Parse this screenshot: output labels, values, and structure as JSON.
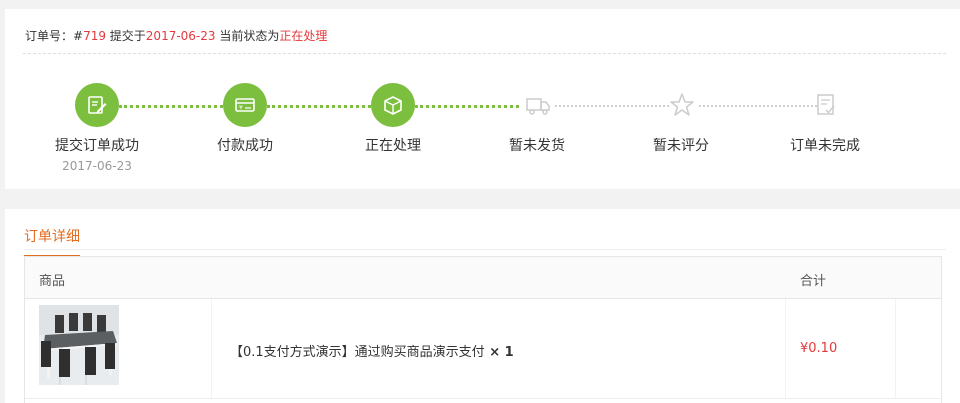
{
  "order": {
    "label_prefix": "订单号：#",
    "number": "719",
    "submitted_label": " 提交于",
    "date": "2017-06-23",
    "status_label": " 当前状态为",
    "status": "正在处理"
  },
  "steps": [
    {
      "label": "提交订单成功",
      "date": "2017-06-23",
      "done": true,
      "icon": "edit-document-icon"
    },
    {
      "label": "付款成功",
      "date": "",
      "done": true,
      "icon": "payment-card-icon"
    },
    {
      "label": "正在处理",
      "date": "",
      "done": true,
      "icon": "package-box-icon"
    },
    {
      "label": "暂未发货",
      "date": "",
      "done": false,
      "icon": "delivery-truck-icon"
    },
    {
      "label": "暂未评分",
      "date": "",
      "done": false,
      "icon": "star-icon"
    },
    {
      "label": "订单未完成",
      "date": "",
      "done": false,
      "icon": "checklist-icon"
    }
  ],
  "colors": {
    "accent_green": "#7cbf3e",
    "accent_orange": "#e56b1f",
    "price_red": "#e4393c",
    "inactive_grey": "#cfcfcf"
  },
  "detail": {
    "tab_label": "订单详细",
    "col_goods": "商品",
    "col_total": "合计",
    "item": {
      "name": "【0.1支付方式演示】通过购买商品演示支付",
      "qty": " × 1",
      "price": "¥0.10",
      "image": "dining-table-set-photo"
    }
  }
}
